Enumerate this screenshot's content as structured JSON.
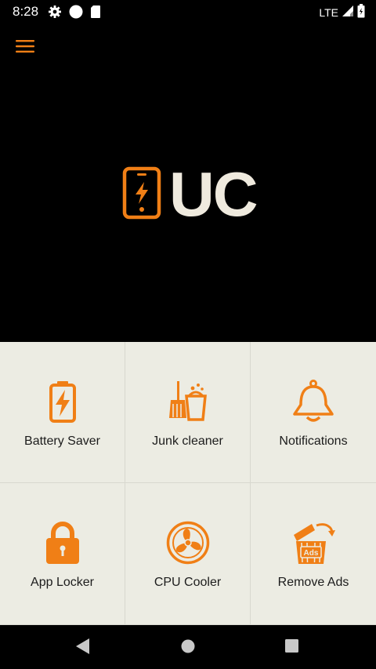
{
  "status_bar": {
    "time": "8:28",
    "network": "LTE",
    "left_icons": [
      "gear-icon",
      "circle-icon",
      "sd-card-icon"
    ],
    "right_icons": [
      "signal-icon",
      "battery-icon"
    ]
  },
  "app_bar": {
    "menu_icon": "hamburger-menu-icon"
  },
  "logo": {
    "text": "UC",
    "icon": "phone-charging-icon",
    "text_color": "#efeade",
    "accent_color": "#f07f16"
  },
  "features": [
    {
      "label": "Battery Saver",
      "icon": "battery-icon"
    },
    {
      "label": "Junk cleaner",
      "icon": "broom-bucket-icon"
    },
    {
      "label": "Notifications",
      "icon": "bell-icon"
    },
    {
      "label": "App Locker",
      "icon": "lock-icon"
    },
    {
      "label": "CPU Cooler",
      "icon": "fan-icon"
    },
    {
      "label": "Remove Ads",
      "icon": "remove-ads-icon",
      "badge": "Ads"
    }
  ],
  "nav_bar": {
    "back_icon": "back-triangle-icon",
    "home_icon": "home-circle-icon",
    "recents_icon": "recents-square-icon"
  },
  "colors": {
    "accent": "#f07f16",
    "grid_background": "#ecece3",
    "background": "#000000"
  }
}
